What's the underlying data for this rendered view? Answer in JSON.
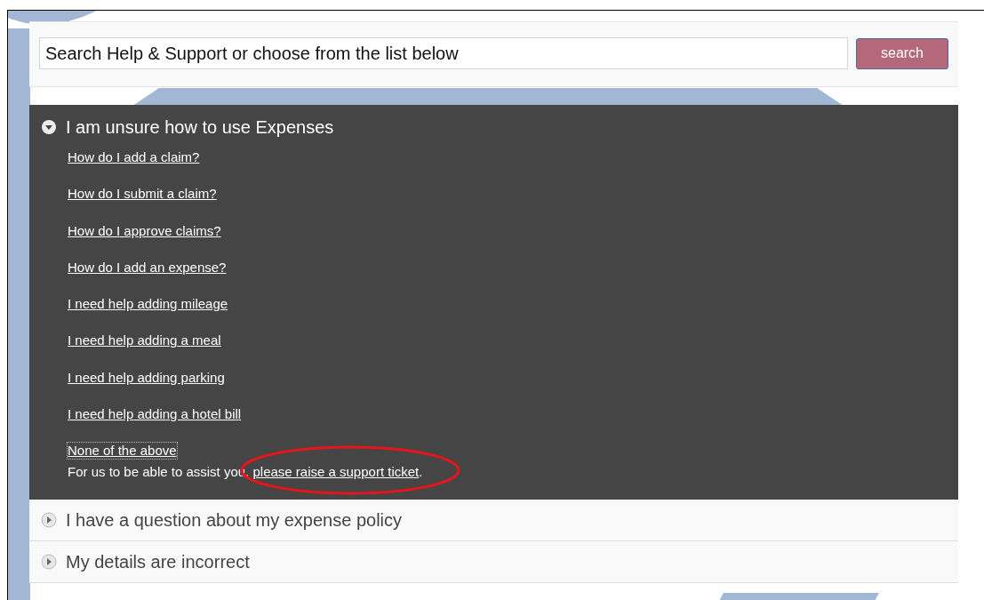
{
  "search": {
    "value": "Search Help & Support or choose from the list below",
    "button": "search"
  },
  "sections": [
    {
      "title": "I am unsure how to use Expenses",
      "expanded": true,
      "links": [
        "How do I add a claim?",
        "How do I submit a claim?",
        "How do I approve claims?",
        "How do I add an expense?",
        "I need help adding mileage",
        "I need help adding a meal",
        "I need help adding parking",
        "I need help adding a hotel bill"
      ],
      "fallback": {
        "link": "None of the above",
        "text_before": "For us to be able to assist you, ",
        "ticket_link": "please raise a support ticket",
        "text_after": "."
      }
    },
    {
      "title": "I have a question about my expense policy",
      "expanded": false
    },
    {
      "title": "My details are incorrect",
      "expanded": false
    }
  ]
}
